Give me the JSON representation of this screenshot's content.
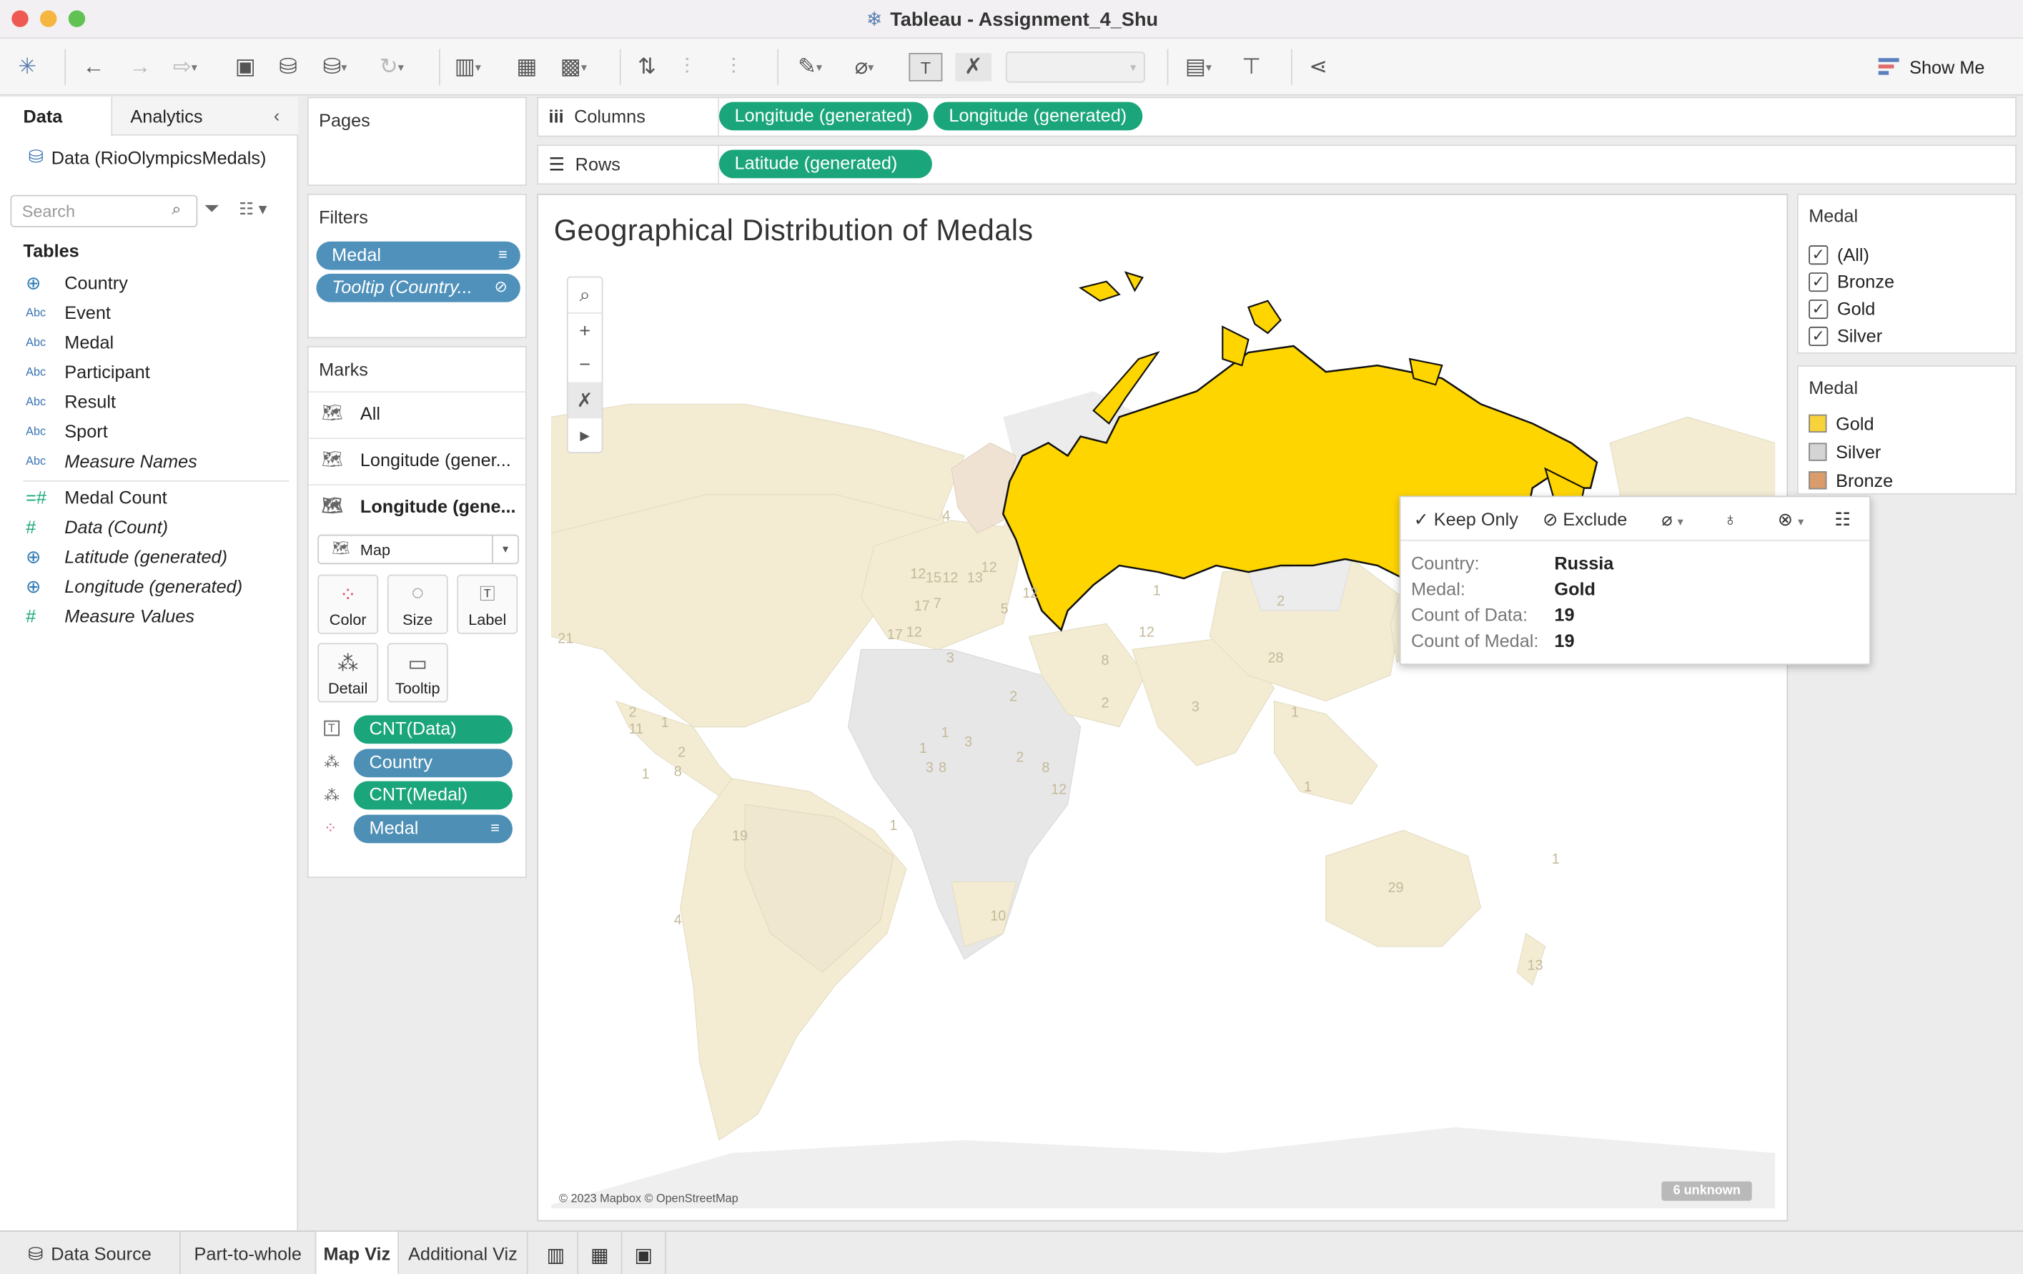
{
  "window": {
    "title": "Tableau - Assignment_4_Shu"
  },
  "toolbar": {
    "show_me_label": "Show Me"
  },
  "data_pane": {
    "tab_data": "Data",
    "tab_analytics": "Analytics",
    "datasource": "Data (RioOlympicsMedals)",
    "search_placeholder": "Search",
    "tables_heading": "Tables",
    "fields": [
      {
        "type": "globe",
        "name": "Country",
        "italic": false
      },
      {
        "type": "Abc",
        "name": "Event",
        "italic": false
      },
      {
        "type": "Abc",
        "name": "Medal",
        "italic": false
      },
      {
        "type": "Abc",
        "name": "Participant",
        "italic": false
      },
      {
        "type": "Abc",
        "name": "Result",
        "italic": false
      },
      {
        "type": "Abc",
        "name": "Sport",
        "italic": false
      },
      {
        "type": "Abc",
        "name": "Measure Names",
        "italic": true
      },
      {
        "type": "=#",
        "name": "Medal Count",
        "italic": false
      },
      {
        "type": "#",
        "name": "Data (Count)",
        "italic": true
      },
      {
        "type": "globe",
        "name": "Latitude (generated)",
        "italic": true
      },
      {
        "type": "globe",
        "name": "Longitude (generated)",
        "italic": true
      },
      {
        "type": "#",
        "name": "Measure Values",
        "italic": true
      }
    ]
  },
  "pages": {
    "label": "Pages"
  },
  "filters": {
    "label": "Filters",
    "pills": [
      "Medal",
      "Tooltip (Country..."
    ]
  },
  "marks": {
    "label": "Marks",
    "rows": [
      "All",
      "Longitude (gener...",
      "Longitude (gene..."
    ],
    "mark_type": "Map",
    "buttons": [
      "Color",
      "Size",
      "Label",
      "Detail",
      "Tooltip"
    ],
    "pills": [
      {
        "icon": "label",
        "text": "CNT(Data)",
        "color": "green"
      },
      {
        "icon": "detail",
        "text": "Country",
        "color": "blue"
      },
      {
        "icon": "detail",
        "text": "CNT(Medal)",
        "color": "green"
      },
      {
        "icon": "color",
        "text": "Medal",
        "color": "blue"
      }
    ]
  },
  "columns": {
    "label": "Columns",
    "pills": [
      "Longitude (generated)",
      "Longitude (generated)"
    ]
  },
  "rows": {
    "label": "Rows",
    "pills": [
      "Latitude (generated)"
    ]
  },
  "viz": {
    "title": "Geographical Distribution of Medals",
    "copyright": "© 2023 Mapbox © OpenStreetMap",
    "unknown_badge": "6 unknown",
    "map_labels": [
      "4",
      "12",
      "15",
      "12",
      "13",
      "12",
      "17",
      "7",
      "17",
      "12",
      "3",
      "5",
      "12",
      "2",
      "28",
      "12",
      "8",
      "2",
      "3",
      "1",
      "1",
      "2",
      "1",
      "3",
      "8",
      "2",
      "3",
      "12",
      "8",
      "1",
      "1",
      "19",
      "1",
      "4",
      "10",
      "29",
      "1",
      "13",
      "21",
      "11",
      "1",
      "2",
      "1",
      "8",
      "2"
    ]
  },
  "tooltip": {
    "keep_only": "Keep Only",
    "exclude": "Exclude",
    "rows": [
      {
        "key": "Country:",
        "value": "Russia"
      },
      {
        "key": "Medal:",
        "value": "Gold"
      },
      {
        "key": "Count of Data:",
        "value": "19"
      },
      {
        "key": "Count of Medal:",
        "value": "19"
      }
    ]
  },
  "medal_filter": {
    "title": "Medal",
    "options": [
      "(All)",
      "Bronze",
      "Gold",
      "Silver"
    ]
  },
  "medal_legend": {
    "title": "Medal",
    "items": [
      {
        "label": "Gold",
        "color": "#f7d23a"
      },
      {
        "label": "Silver",
        "color": "#d4d4d4"
      },
      {
        "label": "Bronze",
        "color": "#d99c6a"
      }
    ]
  },
  "sheet_tabs": {
    "items": [
      "Data Source",
      "Part-to-whole",
      "Map Viz",
      "Additional Viz"
    ],
    "active": "Map Viz"
  },
  "colors": {
    "gold_selected": "#ffd500",
    "gold_faded": "#f3ecd3",
    "silver_faded": "#e7e7e7",
    "bronze_faded": "#eddccd",
    "pill_green": "#1aa67a",
    "pill_blue": "#4d8fb5"
  }
}
